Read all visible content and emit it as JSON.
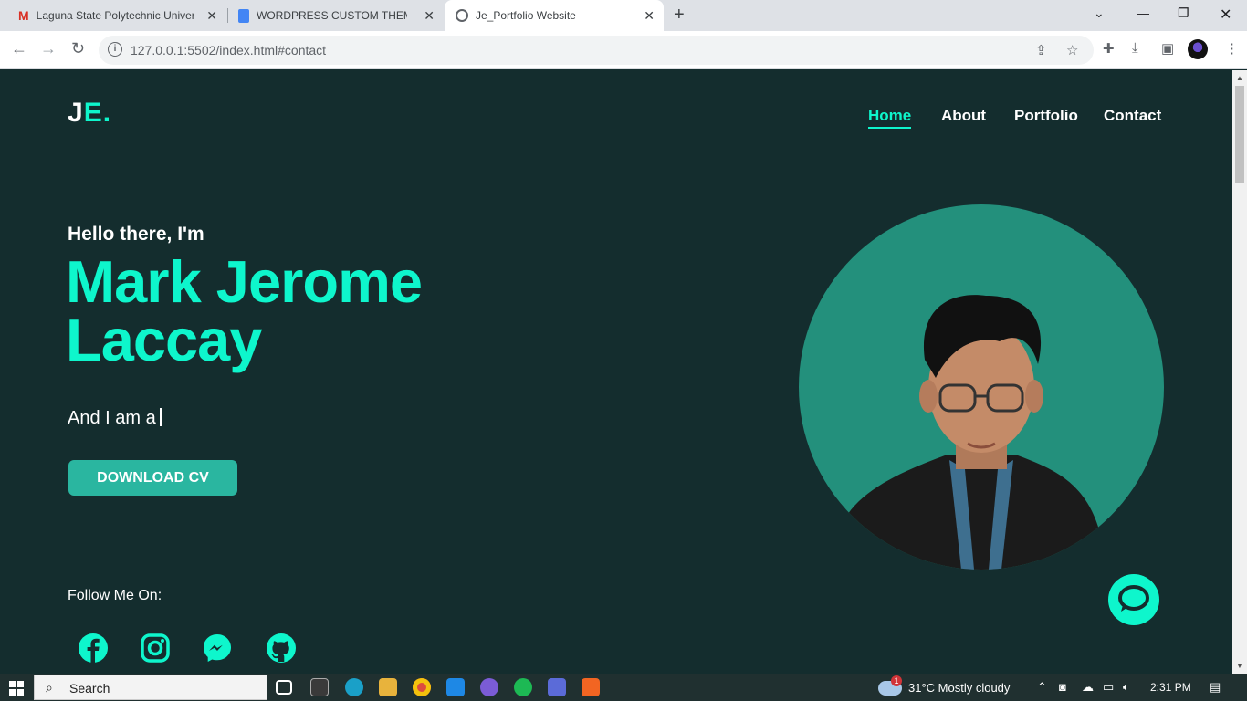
{
  "browser": {
    "tabs": [
      {
        "title": "Laguna State Polytechnic University",
        "icon": "gmail-icon",
        "close": "✕"
      },
      {
        "title": "WORDPRESS CUSTOM THEME - Google Docs",
        "icon": "docs-icon",
        "close": "✕"
      },
      {
        "title": "Je_Portfolio Website",
        "icon": "globe-icon",
        "close": "✕"
      }
    ],
    "new_tab": "+",
    "url": "127.0.0.1:5502/index.html#contact"
  },
  "site": {
    "logo_main": "J",
    "logo_accent": "E.",
    "nav": [
      "Home",
      "About",
      "Portfolio",
      "Contact"
    ],
    "active_nav": "Home",
    "greeting": "Hello there, I'm",
    "name_line1": "Mark Jerome",
    "name_line2": "Laccay",
    "role_prefix": "And I am a",
    "cv_button": "DOWNLOAD CV",
    "follow_label": "Follow Me On:",
    "social_icons": [
      "facebook-icon",
      "instagram-icon",
      "messenger-icon",
      "github-icon"
    ],
    "colors": {
      "accent": "#0ef6cc",
      "background": "#142d2e",
      "button": "#2ab6a0",
      "photo_bg": "#23907c"
    }
  },
  "taskbar": {
    "search_label": "Search",
    "weather_badge": "1",
    "weather": "31°C  Mostly cloudy",
    "time": "2:31 PM"
  }
}
